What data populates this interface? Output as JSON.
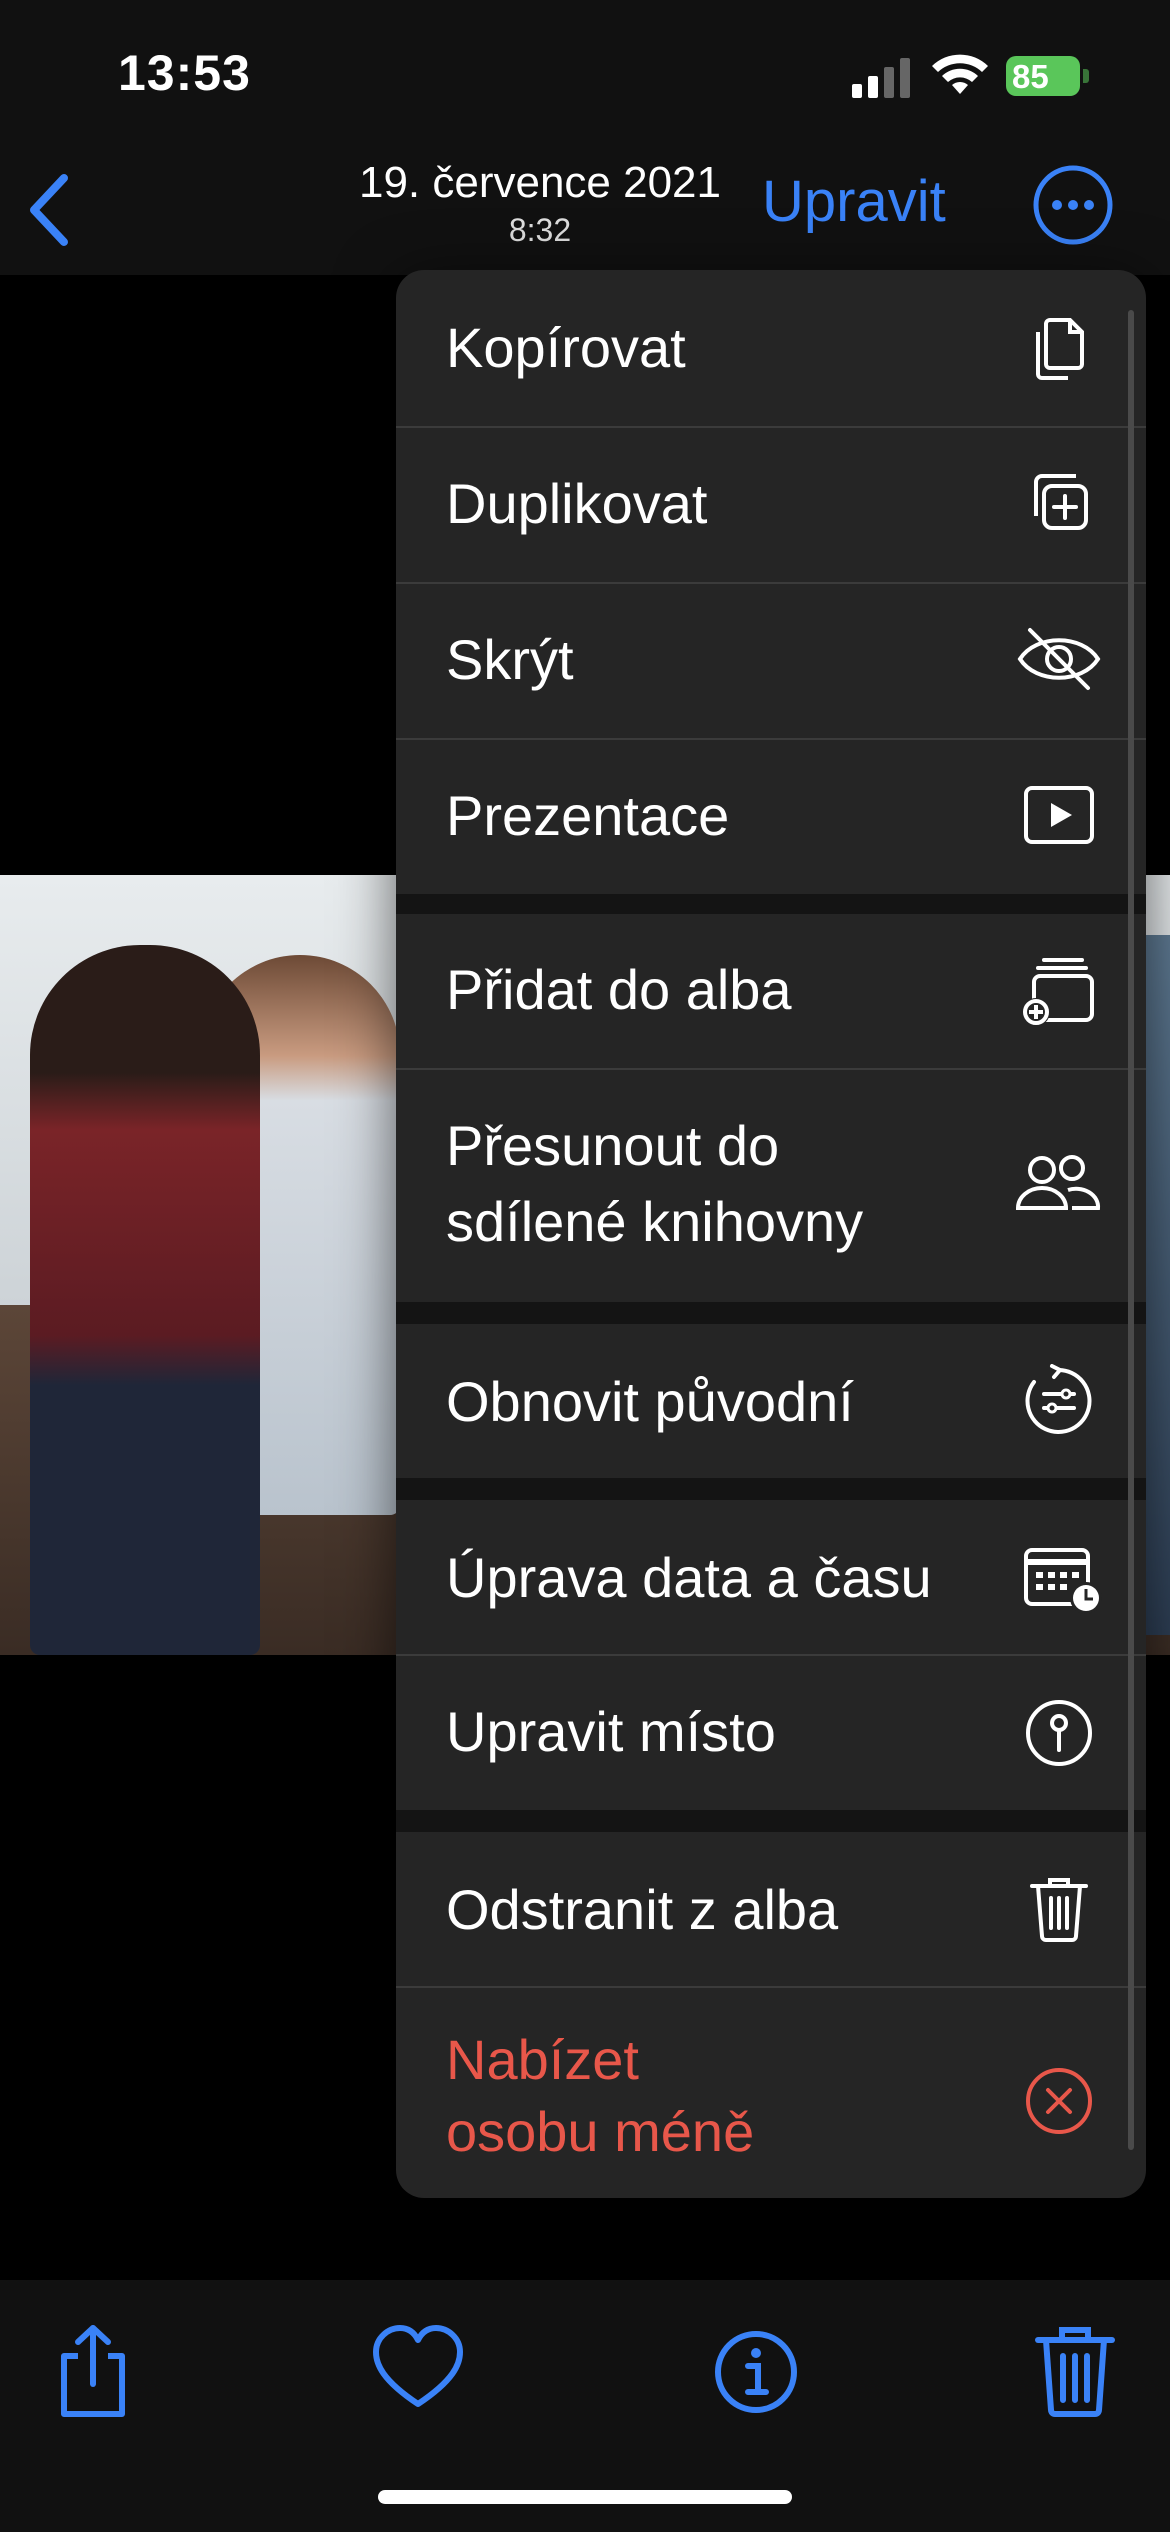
{
  "status_bar": {
    "time": "13:53",
    "battery": "85"
  },
  "nav": {
    "date": "19. července 2021",
    "time": "8:32",
    "edit_label": "Upravit"
  },
  "menu": {
    "items": [
      {
        "label": "Kopírovat",
        "icon": "copy-icon"
      },
      {
        "label": "Duplikovat",
        "icon": "duplicate-icon"
      },
      {
        "label": "Skrýt",
        "icon": "eye-slash-icon"
      },
      {
        "label": "Prezentace",
        "icon": "play-rectangle-icon"
      },
      {
        "label": "Přidat do alba",
        "icon": "add-to-album-icon"
      },
      {
        "label_line1": "Přesunout do",
        "label_line2": "sdílené knihovny",
        "icon": "people-icon"
      },
      {
        "label": "Obnovit původní",
        "icon": "revert-icon"
      },
      {
        "label": "Úprava data a času",
        "icon": "calendar-clock-icon"
      },
      {
        "label": "Upravit místo",
        "icon": "location-icon"
      },
      {
        "label": "Odstranit z alba",
        "icon": "trash-icon"
      },
      {
        "label_line1": "Nabízet",
        "label_line2": "osobu méně",
        "icon": "x-circle-icon",
        "style": "destructive"
      }
    ]
  },
  "toolbar": {
    "icons": [
      "share-icon",
      "heart-icon",
      "info-icon",
      "trash-icon"
    ]
  },
  "colors": {
    "accent": "#3a82f7",
    "destructive": "#e8574a",
    "menu_bg": "#252525"
  }
}
